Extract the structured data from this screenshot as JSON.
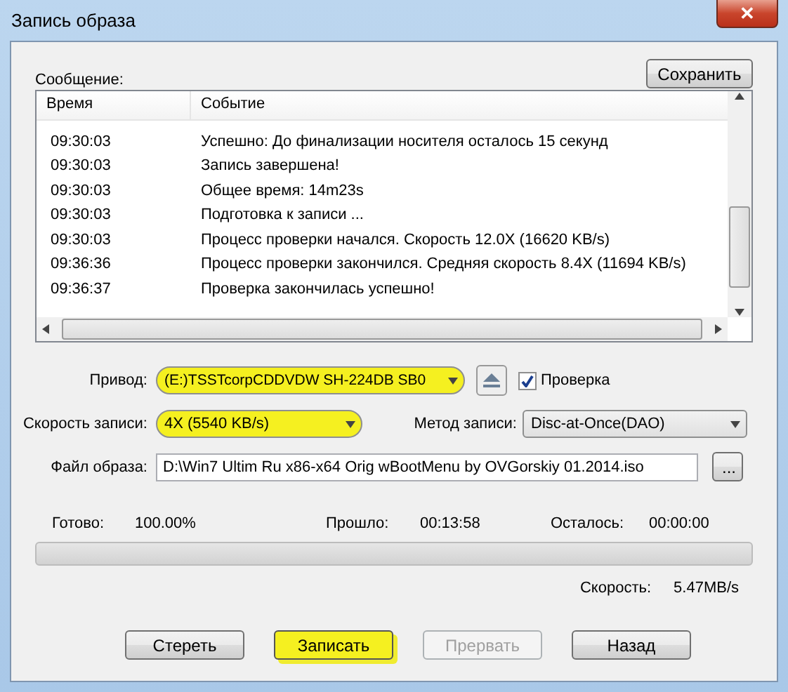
{
  "window": {
    "title": "Запись образа",
    "close": "✕"
  },
  "log": {
    "label": "Сообщение:",
    "save_button": "Сохранить",
    "columns": [
      "Время",
      "Событие"
    ],
    "rows": [
      {
        "time": "09:30:03",
        "event": "Успешно: До финализации носителя осталось 15 секунд"
      },
      {
        "time": "09:30:03",
        "event": "Запись завершена!"
      },
      {
        "time": "09:30:03",
        "event": "Общее время: 14m23s"
      },
      {
        "time": "09:30:03",
        "event": "Подготовка к записи ..."
      },
      {
        "time": "09:30:03",
        "event": "Процесс проверки начался. Скорость 12.0X (16620 KB/s)"
      },
      {
        "time": "09:36:36",
        "event": "Процесс проверки закончился. Средняя скорость 8.4X (11694 KB/s)"
      },
      {
        "time": "09:36:37",
        "event": "Проверка закончилась успешно!"
      }
    ]
  },
  "drive": {
    "label": "Привод:",
    "value": "(E:)TSSTcorpCDDVDW SH-224DB SB0",
    "highlighted": true
  },
  "verify": {
    "label": "Проверка",
    "checked": true
  },
  "speed": {
    "label": "Скорость записи:",
    "value": "4X (5540 KB/s)",
    "highlighted": true
  },
  "method": {
    "label": "Метод записи:",
    "value": "Disc-at-Once(DAO)"
  },
  "image_file": {
    "label": "Файл образа:",
    "value": "D:\\Win7 Ultim Ru x86-x64 Orig wBootMenu by OVGorskiy 01.2014.iso",
    "browse": "..."
  },
  "status": {
    "done_label": "Готово:",
    "done": "100.00%",
    "elapsed_label": "Прошло:",
    "elapsed": "00:13:58",
    "remaining_label": "Осталось:",
    "remaining": "00:00:00",
    "speed_label": "Скорость:",
    "speed": "5.47MB/s"
  },
  "progress": {
    "level": 0
  },
  "buttons": [
    {
      "label": "Стереть",
      "disabled": false,
      "highlighted": false
    },
    {
      "label": "Записать",
      "disabled": false,
      "highlighted": true
    },
    {
      "label": "Прервать",
      "disabled": true,
      "highlighted": false
    },
    {
      "label": "Назад",
      "disabled": false,
      "highlighted": false
    }
  ]
}
